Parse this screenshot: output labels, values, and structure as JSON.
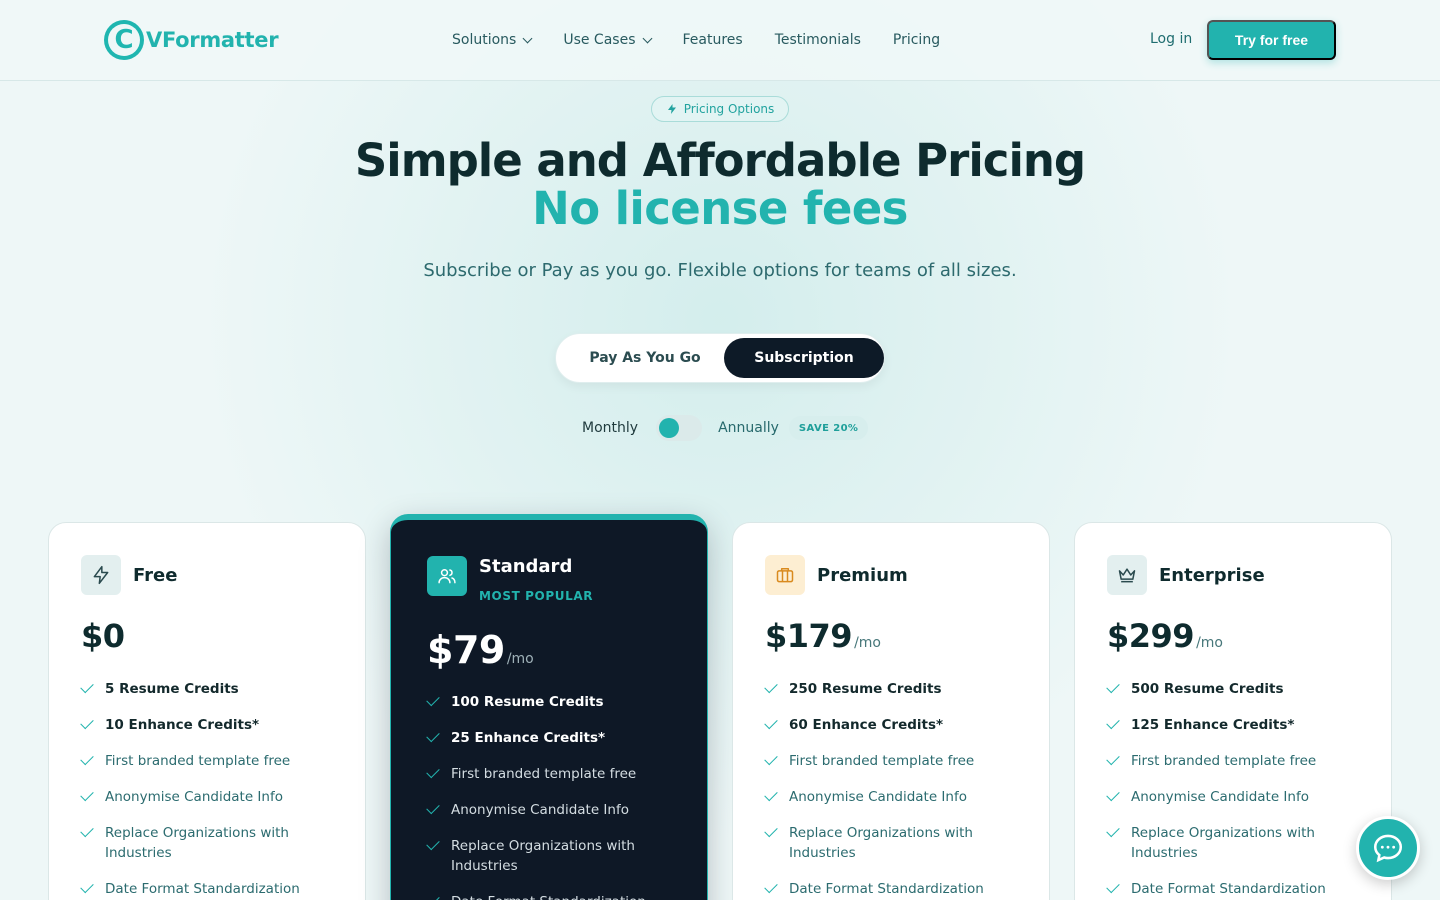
{
  "brand": {
    "name": "VFormatter",
    "accent": "#22b3ae"
  },
  "nav": {
    "items": [
      {
        "label": "Solutions",
        "dropdown": true
      },
      {
        "label": "Use Cases",
        "dropdown": true
      },
      {
        "label": "Features",
        "dropdown": false
      },
      {
        "label": "Testimonials",
        "dropdown": false
      },
      {
        "label": "Pricing",
        "dropdown": false
      }
    ],
    "login": "Log in",
    "cta": "Try for free"
  },
  "hero": {
    "badge": "Pricing Options",
    "title": "Simple and Affordable Pricing",
    "title_accent": "No license fees",
    "subtitle": "Subscribe or Pay as you go. Flexible options for teams of all sizes."
  },
  "plan_type": {
    "options": [
      "Pay As You Go",
      "Subscription"
    ],
    "selected": "Subscription"
  },
  "billing": {
    "monthly": "Monthly",
    "annually": "Annually",
    "save_badge": "SAVE 20%",
    "selected": "Monthly"
  },
  "plans": [
    {
      "name": "Free",
      "icon": "bolt-icon",
      "price": "$0",
      "period": "",
      "features": [
        "5 Resume Credits",
        "10 Enhance Credits*",
        "First branded template free",
        "Anonymise Candidate Info",
        "Replace Organizations with Industries",
        "Date Format Standardization"
      ]
    },
    {
      "name": "Standard",
      "icon": "users-icon",
      "popular": "MOST POPULAR",
      "price": "$79",
      "period": "/mo",
      "features": [
        "100 Resume Credits",
        "25 Enhance Credits*",
        "First branded template free",
        "Anonymise Candidate Info",
        "Replace Organizations with Industries",
        "Date Format Standardization"
      ]
    },
    {
      "name": "Premium",
      "icon": "briefcase-icon",
      "price": "$179",
      "period": "/mo",
      "features": [
        "250 Resume Credits",
        "60 Enhance Credits*",
        "First branded template free",
        "Anonymise Candidate Info",
        "Replace Organizations with Industries",
        "Date Format Standardization"
      ]
    },
    {
      "name": "Enterprise",
      "icon": "crown-icon",
      "price": "$299",
      "period": "/mo",
      "features": [
        "500 Resume Credits",
        "125 Enhance Credits*",
        "First branded template free",
        "Anonymise Candidate Info",
        "Replace Organizations with Industries",
        "Date Format Standardization"
      ]
    }
  ],
  "chat": {
    "icon": "chat-icon"
  }
}
